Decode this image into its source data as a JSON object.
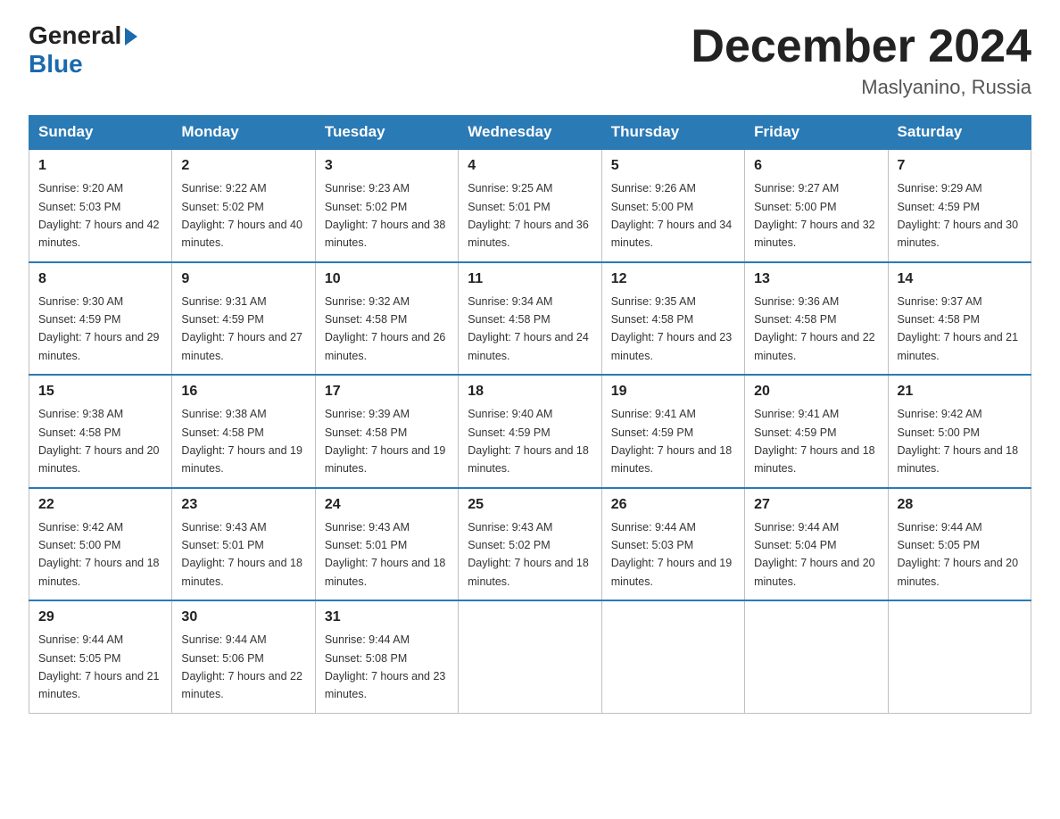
{
  "logo": {
    "general": "General",
    "blue": "Blue"
  },
  "title": "December 2024",
  "location": "Maslyanino, Russia",
  "days_of_week": [
    "Sunday",
    "Monday",
    "Tuesday",
    "Wednesday",
    "Thursday",
    "Friday",
    "Saturday"
  ],
  "weeks": [
    [
      {
        "num": "1",
        "sunrise": "9:20 AM",
        "sunset": "5:03 PM",
        "daylight": "7 hours and 42 minutes."
      },
      {
        "num": "2",
        "sunrise": "9:22 AM",
        "sunset": "5:02 PM",
        "daylight": "7 hours and 40 minutes."
      },
      {
        "num": "3",
        "sunrise": "9:23 AM",
        "sunset": "5:02 PM",
        "daylight": "7 hours and 38 minutes."
      },
      {
        "num": "4",
        "sunrise": "9:25 AM",
        "sunset": "5:01 PM",
        "daylight": "7 hours and 36 minutes."
      },
      {
        "num": "5",
        "sunrise": "9:26 AM",
        "sunset": "5:00 PM",
        "daylight": "7 hours and 34 minutes."
      },
      {
        "num": "6",
        "sunrise": "9:27 AM",
        "sunset": "5:00 PM",
        "daylight": "7 hours and 32 minutes."
      },
      {
        "num": "7",
        "sunrise": "9:29 AM",
        "sunset": "4:59 PM",
        "daylight": "7 hours and 30 minutes."
      }
    ],
    [
      {
        "num": "8",
        "sunrise": "9:30 AM",
        "sunset": "4:59 PM",
        "daylight": "7 hours and 29 minutes."
      },
      {
        "num": "9",
        "sunrise": "9:31 AM",
        "sunset": "4:59 PM",
        "daylight": "7 hours and 27 minutes."
      },
      {
        "num": "10",
        "sunrise": "9:32 AM",
        "sunset": "4:58 PM",
        "daylight": "7 hours and 26 minutes."
      },
      {
        "num": "11",
        "sunrise": "9:34 AM",
        "sunset": "4:58 PM",
        "daylight": "7 hours and 24 minutes."
      },
      {
        "num": "12",
        "sunrise": "9:35 AM",
        "sunset": "4:58 PM",
        "daylight": "7 hours and 23 minutes."
      },
      {
        "num": "13",
        "sunrise": "9:36 AM",
        "sunset": "4:58 PM",
        "daylight": "7 hours and 22 minutes."
      },
      {
        "num": "14",
        "sunrise": "9:37 AM",
        "sunset": "4:58 PM",
        "daylight": "7 hours and 21 minutes."
      }
    ],
    [
      {
        "num": "15",
        "sunrise": "9:38 AM",
        "sunset": "4:58 PM",
        "daylight": "7 hours and 20 minutes."
      },
      {
        "num": "16",
        "sunrise": "9:38 AM",
        "sunset": "4:58 PM",
        "daylight": "7 hours and 19 minutes."
      },
      {
        "num": "17",
        "sunrise": "9:39 AM",
        "sunset": "4:58 PM",
        "daylight": "7 hours and 19 minutes."
      },
      {
        "num": "18",
        "sunrise": "9:40 AM",
        "sunset": "4:59 PM",
        "daylight": "7 hours and 18 minutes."
      },
      {
        "num": "19",
        "sunrise": "9:41 AM",
        "sunset": "4:59 PM",
        "daylight": "7 hours and 18 minutes."
      },
      {
        "num": "20",
        "sunrise": "9:41 AM",
        "sunset": "4:59 PM",
        "daylight": "7 hours and 18 minutes."
      },
      {
        "num": "21",
        "sunrise": "9:42 AM",
        "sunset": "5:00 PM",
        "daylight": "7 hours and 18 minutes."
      }
    ],
    [
      {
        "num": "22",
        "sunrise": "9:42 AM",
        "sunset": "5:00 PM",
        "daylight": "7 hours and 18 minutes."
      },
      {
        "num": "23",
        "sunrise": "9:43 AM",
        "sunset": "5:01 PM",
        "daylight": "7 hours and 18 minutes."
      },
      {
        "num": "24",
        "sunrise": "9:43 AM",
        "sunset": "5:01 PM",
        "daylight": "7 hours and 18 minutes."
      },
      {
        "num": "25",
        "sunrise": "9:43 AM",
        "sunset": "5:02 PM",
        "daylight": "7 hours and 18 minutes."
      },
      {
        "num": "26",
        "sunrise": "9:44 AM",
        "sunset": "5:03 PM",
        "daylight": "7 hours and 19 minutes."
      },
      {
        "num": "27",
        "sunrise": "9:44 AM",
        "sunset": "5:04 PM",
        "daylight": "7 hours and 20 minutes."
      },
      {
        "num": "28",
        "sunrise": "9:44 AM",
        "sunset": "5:05 PM",
        "daylight": "7 hours and 20 minutes."
      }
    ],
    [
      {
        "num": "29",
        "sunrise": "9:44 AM",
        "sunset": "5:05 PM",
        "daylight": "7 hours and 21 minutes."
      },
      {
        "num": "30",
        "sunrise": "9:44 AM",
        "sunset": "5:06 PM",
        "daylight": "7 hours and 22 minutes."
      },
      {
        "num": "31",
        "sunrise": "9:44 AM",
        "sunset": "5:08 PM",
        "daylight": "7 hours and 23 minutes."
      },
      null,
      null,
      null,
      null
    ]
  ]
}
